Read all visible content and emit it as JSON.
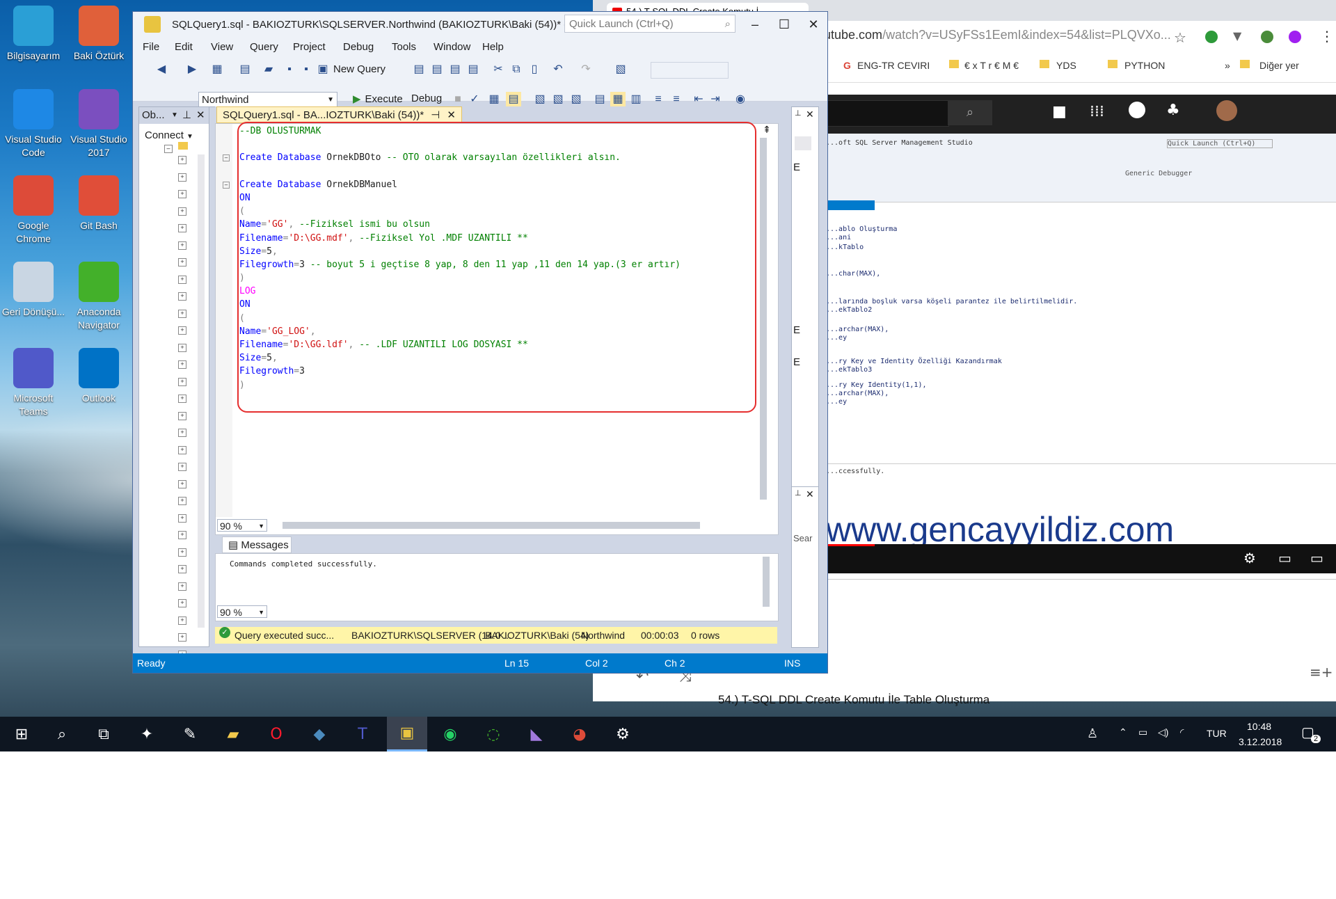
{
  "desktop_icons": [
    {
      "label": "Bilgisayarım",
      "icon": "computer-icon",
      "color": "#2a9fd6"
    },
    {
      "label": "Baki Öztürk",
      "icon": "user-folder-icon",
      "color": "#e0603a"
    },
    {
      "label": "Visual Studio Code",
      "icon": "vscode-icon",
      "color": "#1e88e5"
    },
    {
      "label": "Visual Studio 2017",
      "icon": "visual-studio-icon",
      "color": "#7b4fbf"
    },
    {
      "label": "Google Chrome",
      "icon": "chrome-icon",
      "color": "#dd4b39"
    },
    {
      "label": "Git Bash",
      "icon": "git-bash-icon",
      "color": "#e04e39"
    },
    {
      "label": "Geri Dönüşü...",
      "icon": "recycle-bin-icon",
      "color": "#c9d6e3"
    },
    {
      "label": "Anaconda Navigator",
      "icon": "anaconda-icon",
      "color": "#43b02a"
    },
    {
      "label": "Microsoft Teams",
      "icon": "teams-icon",
      "color": "#5059c9"
    },
    {
      "label": "Outlook",
      "icon": "outlook-icon",
      "color": "#0072c6"
    }
  ],
  "ssms": {
    "title": "SQLQuery1.sql - BAKIOZTURK\\SQLSERVER.Northwind (BAKIOZTURK\\Baki (54))* - ...",
    "quick_launch_placeholder": "Quick Launch (Ctrl+Q)",
    "menu": [
      "File",
      "Edit",
      "View",
      "Query",
      "Project",
      "Debug",
      "Tools",
      "Window",
      "Help"
    ],
    "toolbar": {
      "new_query": "New Query",
      "database": "Northwind",
      "execute": "Execute",
      "debug": "Debug"
    },
    "object_explorer": {
      "title": "Ob...",
      "connect": "Connect"
    },
    "tab": "SQLQuery1.sql - BA...IOZTURK\\Baki (54))*",
    "code_lines": [
      [
        {
          "t": "--DB OLUSTURMAK",
          "c": "c"
        }
      ],
      [],
      [
        {
          "t": "Create Database",
          "c": "k"
        },
        {
          "t": " OrnekDBOto ",
          "c": "n"
        },
        {
          "t": "-- OTO olarak varsayılan özellikleri alsın.",
          "c": "c"
        }
      ],
      [],
      [
        {
          "t": "Create Database",
          "c": "k"
        },
        {
          "t": " OrnekDBManuel",
          "c": "n"
        }
      ],
      [
        {
          "t": "ON",
          "c": "k"
        }
      ],
      [
        {
          "t": "(",
          "c": "g"
        }
      ],
      [
        {
          "t": "Name",
          "c": "k"
        },
        {
          "t": "=",
          "c": "g"
        },
        {
          "t": "'GG'",
          "c": "s"
        },
        {
          "t": ", ",
          "c": "g"
        },
        {
          "t": "--Fiziksel ismi bu olsun",
          "c": "c"
        }
      ],
      [
        {
          "t": "Filename",
          "c": "k"
        },
        {
          "t": "=",
          "c": "g"
        },
        {
          "t": "'D:\\GG.mdf'",
          "c": "s"
        },
        {
          "t": ", ",
          "c": "g"
        },
        {
          "t": "--Fiziksel Yol .MDF UZANTILI **",
          "c": "c"
        }
      ],
      [
        {
          "t": "Size",
          "c": "k"
        },
        {
          "t": "=",
          "c": "g"
        },
        {
          "t": "5",
          "c": "n"
        },
        {
          "t": ",",
          "c": "g"
        }
      ],
      [
        {
          "t": "Filegrowth",
          "c": "k"
        },
        {
          "t": "=",
          "c": "g"
        },
        {
          "t": "3",
          "c": "n"
        },
        {
          "t": " -- boyut 5 i geçtise 8 yap, 8 den 11 yap ,11 den 14 yap.(3 er artır)",
          "c": "c"
        }
      ],
      [
        {
          "t": ")",
          "c": "g"
        }
      ],
      [
        {
          "t": "LOG",
          "c": "m"
        }
      ],
      [
        {
          "t": "ON",
          "c": "k"
        }
      ],
      [
        {
          "t": "(",
          "c": "g"
        }
      ],
      [
        {
          "t": "Name",
          "c": "k"
        },
        {
          "t": "=",
          "c": "g"
        },
        {
          "t": "'GG_LOG'",
          "c": "s"
        },
        {
          "t": ",",
          "c": "g"
        }
      ],
      [
        {
          "t": "Filename",
          "c": "k"
        },
        {
          "t": "=",
          "c": "g"
        },
        {
          "t": "'D:\\GG.ldf'",
          "c": "s"
        },
        {
          "t": ", ",
          "c": "g"
        },
        {
          "t": "-- .LDF UZANTILI LOG DOSYASI **",
          "c": "c"
        }
      ],
      [
        {
          "t": "Size",
          "c": "k"
        },
        {
          "t": "=",
          "c": "g"
        },
        {
          "t": "5",
          "c": "n"
        },
        {
          "t": ",",
          "c": "g"
        }
      ],
      [
        {
          "t": "Filegrowth",
          "c": "k"
        },
        {
          "t": "=",
          "c": "g"
        },
        {
          "t": "3",
          "c": "n"
        }
      ],
      [
        {
          "t": ")",
          "c": "g"
        }
      ]
    ],
    "zoom_editor": "90 %",
    "zoom_results": "90 %",
    "messages_tab": "Messages",
    "messages_text": "Commands completed successfully.",
    "query_status": {
      "message": "Query executed succ...",
      "server": "BAKIOZTURK\\SQLSERVER (14.0 ...",
      "user": "BAKIOZTURK\\Baki (54)",
      "database": "Northwind",
      "elapsed": "00:00:03",
      "rows": "0 rows"
    },
    "statusbar": {
      "ready": "Ready",
      "ln": "Ln 15",
      "col": "Col 2",
      "ch": "Ch 2",
      "mode": "INS"
    },
    "side_search": "Sear"
  },
  "browser": {
    "tab_title": "54.) T-SQL DDL Create Komutu İ...",
    "url_host": "utube.com",
    "url_path": "/watch?v=USyFSs1EemI&index=54&list=PLQVXo...",
    "bookmarks": [
      "ENG-TR CEVIRI",
      "€ x T r € M €",
      "YDS",
      "PYTHON"
    ],
    "other_bookmarks": "Diğer yer",
    "video_watermark": "www.gencayyildiz.com",
    "video_title": "54.) T-SQL DDL Create Komutu İle Table Oluşturma",
    "video_frame": {
      "app_title": "...oft SQL Server Management Studio",
      "quick_launch": "Quick Launch (Ctrl+Q)",
      "debugger": "Generic Debugger",
      "lines": [
        "...ablo Oluşturma",
        "...ani",
        "...kTablo",
        "...char(MAX),",
        "...larında boşluk varsa köşeli parantez ile belirtilmelidir.",
        "...ekTablo2",
        "...archar(MAX),",
        "...ey",
        "...ry Key ve Identity Özelliği Kazandırmak",
        "...ekTablo3",
        "...ry Key Identity(1,1),",
        "...archar(MAX),",
        "...ey"
      ],
      "message": "...ccessfully."
    }
  },
  "taskbar": {
    "language": "TUR",
    "time": "10:48",
    "date": "3.12.2018",
    "notifications": "2"
  }
}
